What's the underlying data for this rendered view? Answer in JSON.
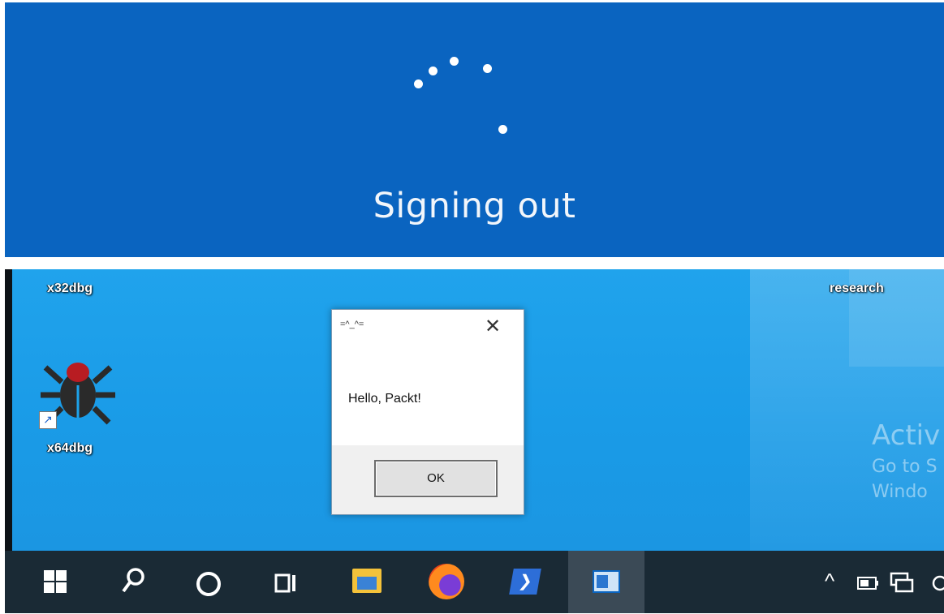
{
  "signout": {
    "text": "Signing out",
    "background": "#0a64c0"
  },
  "desktop": {
    "icons": [
      {
        "label": "x32dbg",
        "icon": "desktop-label"
      },
      {
        "label": "x64dbg",
        "icon": "bug-icon"
      },
      {
        "label": "research",
        "icon": "desktop-label"
      }
    ],
    "watermark": {
      "line1": "Activ",
      "line2": "Go to S",
      "line3": "Windo"
    }
  },
  "messagebox": {
    "title": "=^_^=",
    "close_glyph": "✕",
    "message": "Hello, Packt!",
    "ok_label": "OK"
  },
  "taskbar": {
    "items": [
      "windows-start-icon",
      "search-icon",
      "cortana-icon",
      "task-view-icon",
      "file-explorer-icon",
      "firefox-icon",
      "powershell-icon",
      "active-app-icon"
    ],
    "tray": [
      "chevron-up-icon",
      "battery-icon",
      "network-icon"
    ],
    "tray_glyphs": {
      "chevron": "^"
    }
  }
}
